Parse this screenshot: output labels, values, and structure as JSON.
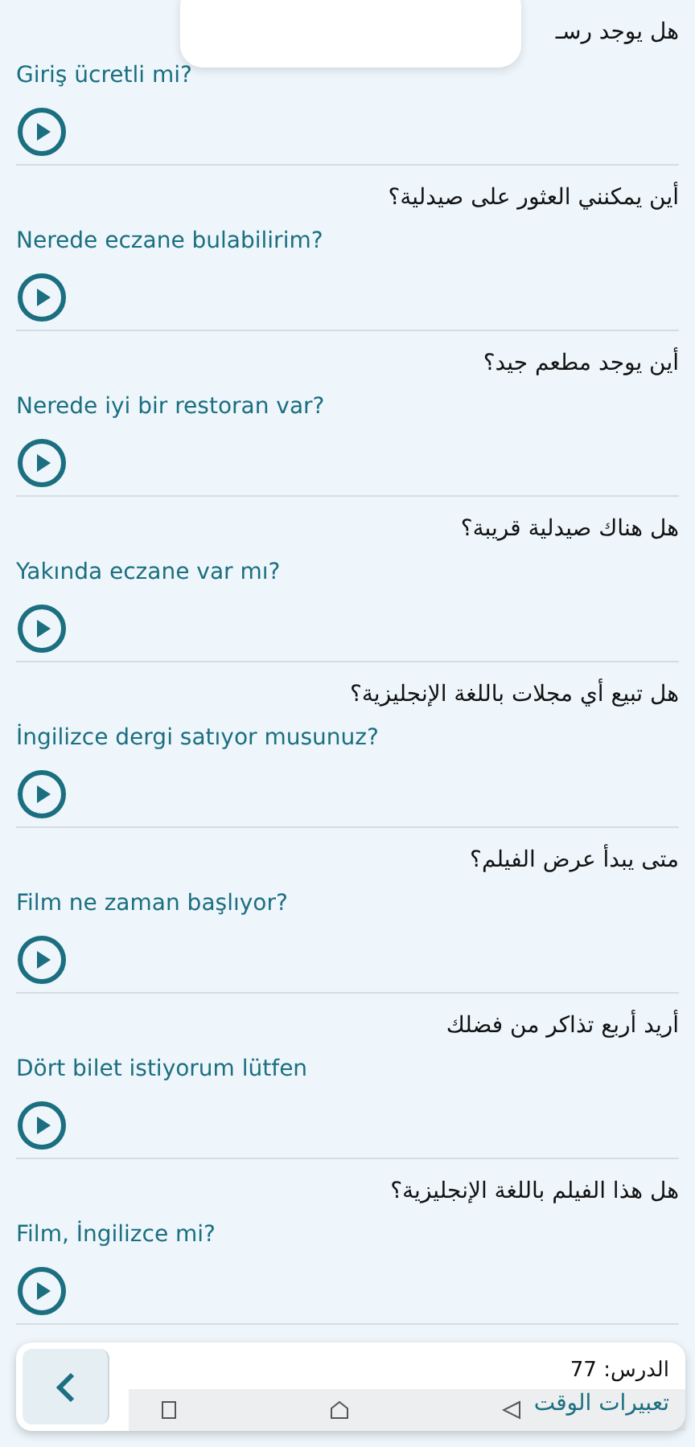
{
  "phrases": [
    {
      "arabic": "هل يوجد رسـ",
      "turkish": "Giriş ücretli mi?"
    },
    {
      "arabic": "أين يمكنني العثور على صيدلية؟",
      "turkish": "Nerede eczane bulabilirim?"
    },
    {
      "arabic": "أين يوجد مطعم جيد؟",
      "turkish": "Nerede iyi bir restoran var?"
    },
    {
      "arabic": "هل هناك صيدلية قريبة؟",
      "turkish": "Yakında eczane var mı?"
    },
    {
      "arabic": "هل تبيع أي مجلات باللغة الإنجليزية؟",
      "turkish": "İngilizce dergi satıyor musunuz?"
    },
    {
      "arabic": "متى يبدأ عرض الفيلم؟",
      "turkish": "Film ne zaman başlıyor?"
    },
    {
      "arabic": "أريد أربع تذاكر من فضلك",
      "turkish": "Dört bilet istiyorum lütfen"
    },
    {
      "arabic": "هل هذا الفيلم باللغة الإنجليزية؟",
      "turkish": "Film, İngilizce mi?"
    }
  ],
  "footer": {
    "lesson": "الدرس: 77",
    "title": "تعبيرات الوقت"
  }
}
